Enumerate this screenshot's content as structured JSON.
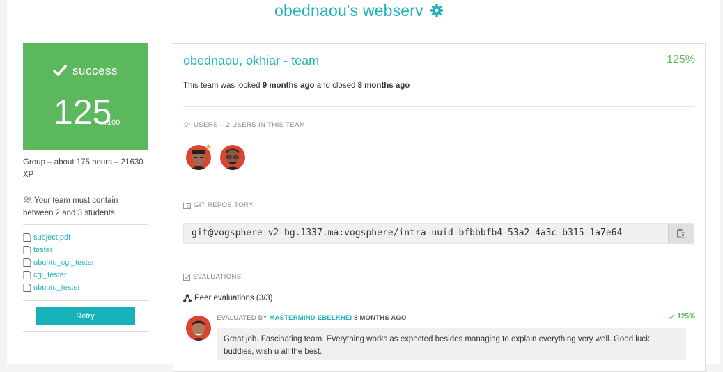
{
  "header": {
    "title": "obednaou's webserv",
    "settings_icon": "gear-icon"
  },
  "status": {
    "label": "success",
    "grade": "125",
    "grade_max": "/100"
  },
  "project_meta": {
    "group_info": "Group – about 175 hours – 21630 XP",
    "team_size_info": "Your team must contain between 2 and 3 students"
  },
  "files": [
    {
      "name": "subject.pdf"
    },
    {
      "name": "tester"
    },
    {
      "name": "ubuntu_cgi_tester"
    },
    {
      "name": "cgi_tester"
    },
    {
      "name": "ubuntu_tester"
    }
  ],
  "retry_label": "Retry",
  "team": {
    "name": "obednaou, okhiar - team",
    "score": "125%",
    "locked_prefix": "This team was locked",
    "locked_time": "9 months ago",
    "closed_prefix": "and closed",
    "closed_time": "8 months ago"
  },
  "users_section": {
    "label": "USERS – 2 USERS IN THIS TEAM"
  },
  "git_section": {
    "label": "GIT REPOSITORY",
    "url": "git@vogsphere-v2-bg.1337.ma:vogsphere/intra-uuid-bfbbbfb4-53a2-4a3c-b315-1a7e64"
  },
  "evaluations_section": {
    "label": "EVALUATIONS",
    "peer_label": "Peer evaluations (3/3)"
  },
  "evaluation": {
    "prefix": "EVALUATED BY",
    "evaluator": "MASTERMIND EBELKHEI",
    "time": "8 MONTHS AGO",
    "score": "125%",
    "comment": "Great job. Fascinating team. Everything works as expected besides managing to explain everything very well. Good luck buddies, wish u all the best."
  },
  "colors": {
    "accent": "#1fb4bb",
    "success": "#5cb85c"
  }
}
